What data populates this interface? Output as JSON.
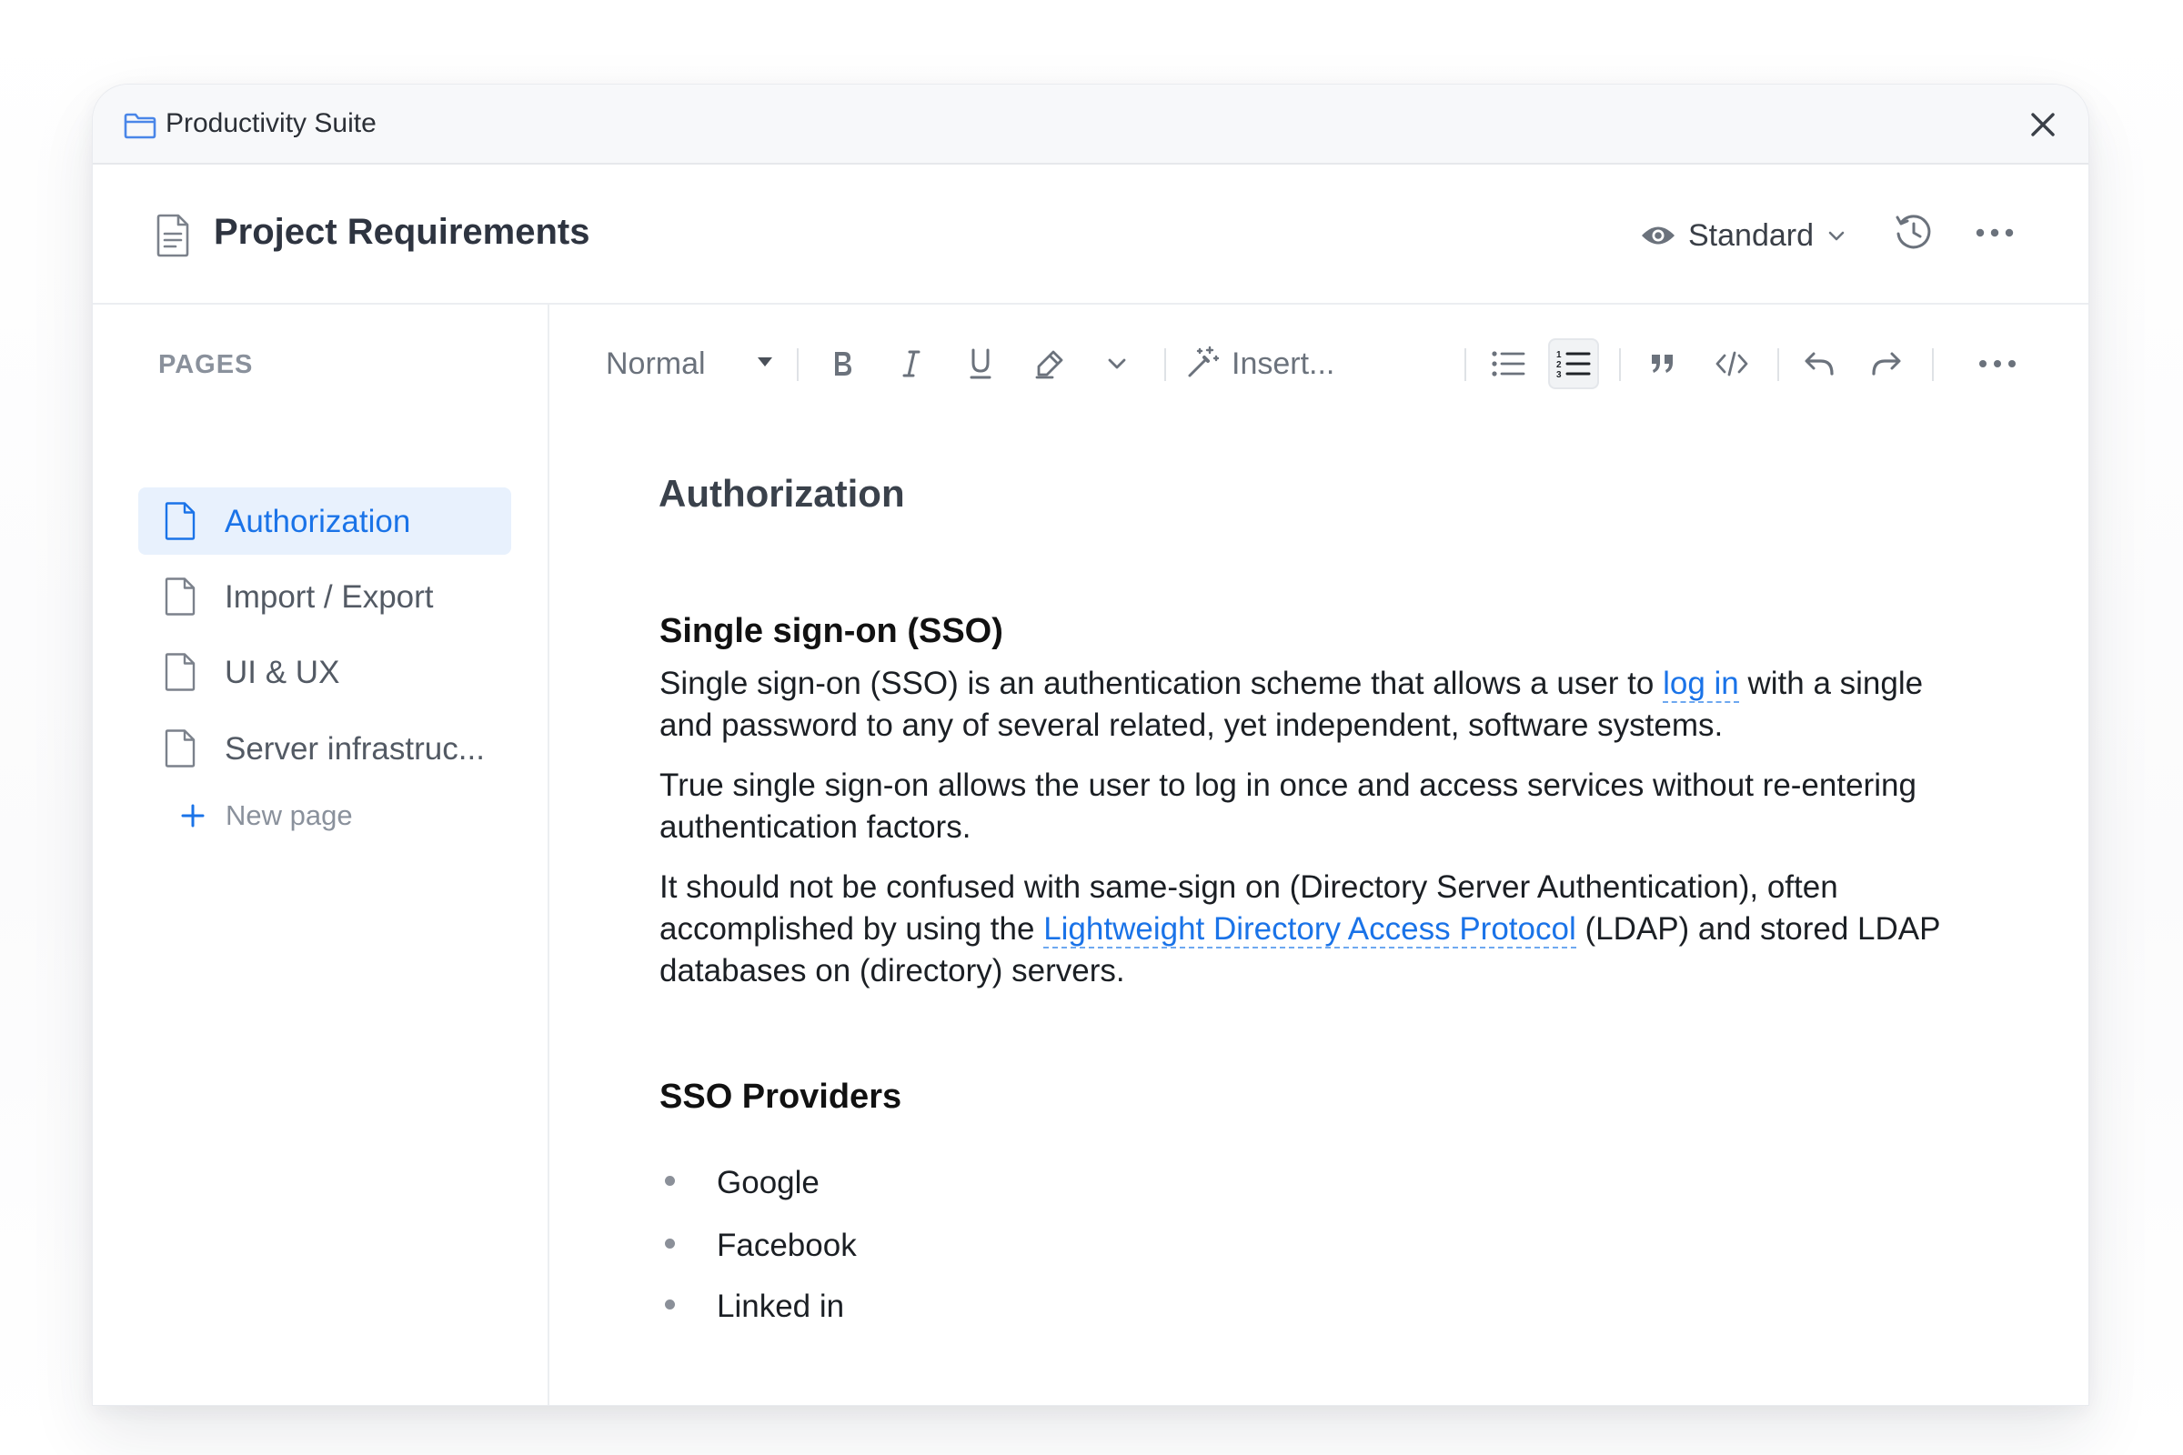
{
  "app": {
    "title": "Productivity Suite"
  },
  "document": {
    "title": "Project Requirements",
    "view_mode": "Standard"
  },
  "sidebar": {
    "section_label": "PAGES",
    "pages": [
      {
        "label": "Authorization",
        "active": true
      },
      {
        "label": "Import / Export",
        "active": false
      },
      {
        "label": "UI & UX",
        "active": false
      },
      {
        "label": "Server infrastruc...",
        "active": false
      }
    ],
    "new_page_label": "New page"
  },
  "toolbar": {
    "text_style": "Normal",
    "insert_label": "Insert...",
    "buttons": [
      "bold",
      "italic",
      "underline",
      "highlight",
      "more-formatting",
      "insert",
      "bullet-list",
      "numbered-list",
      "quote",
      "code",
      "undo",
      "redo",
      "more"
    ],
    "active_button": "numbered-list"
  },
  "content": {
    "page_heading": "Authorization",
    "section1": {
      "heading": "Single sign-on (SSO)",
      "p1_before": "Single sign-on (SSO) is an authentication scheme that allows a user to ",
      "p1_link": "log in",
      "p1_after": " with a single and password to any of several related, yet independent, software systems.",
      "p2": "True single sign-on allows the user to log in once and access services without re-entering authentication factors.",
      "p3_before": "It should not be confused with same-sign on (Directory Server Authentication), often accomplished by using the ",
      "p3_link": "Lightweight Directory Access Protocol",
      "p3_after": " (LDAP) and stored LDAP databases on (directory) servers."
    },
    "section2": {
      "heading": "SSO Providers",
      "items": [
        "Google",
        "Facebook",
        "Linked in"
      ]
    }
  },
  "colors": {
    "accent": "#1a73e8",
    "active_bg": "#e8f1fd",
    "muted": "#8a919c"
  }
}
